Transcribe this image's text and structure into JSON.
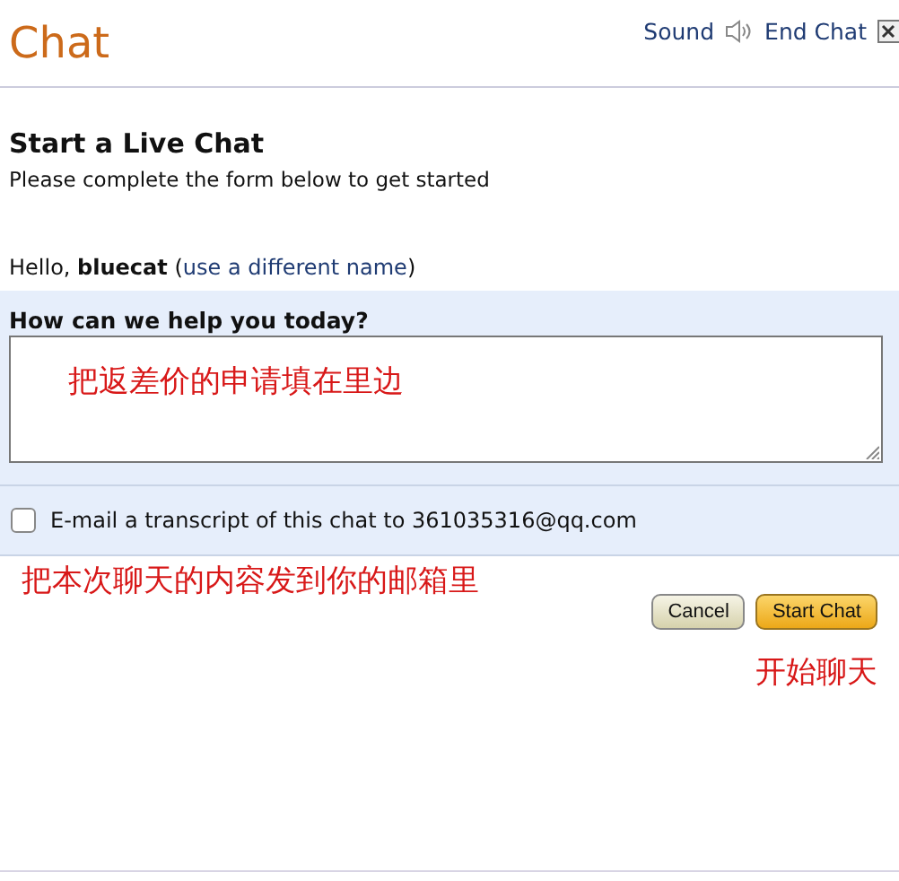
{
  "header": {
    "title": "Chat",
    "sound_label": "Sound",
    "end_label": "End Chat"
  },
  "intro": {
    "heading": "Start a Live Chat",
    "subtitle": "Please complete the form below to get started"
  },
  "greeting": {
    "prefix": "Hello,",
    "name": "bluecat",
    "open_paren": "(",
    "link": "use a different name",
    "close_paren": ")"
  },
  "question": {
    "label": "How can we help you today?",
    "annotation": "把返差价的申请填在里边"
  },
  "transcript": {
    "label": "E-mail a transcript of this chat to 361035316@qq.com",
    "checked": false,
    "annotation": "把本次聊天的内容发到你的邮箱里"
  },
  "buttons": [
    {
      "label": "Cancel",
      "kind": "secondary"
    },
    {
      "label": "Start Chat",
      "kind": "primary"
    }
  ],
  "buttons_annotation": "开始聊天"
}
